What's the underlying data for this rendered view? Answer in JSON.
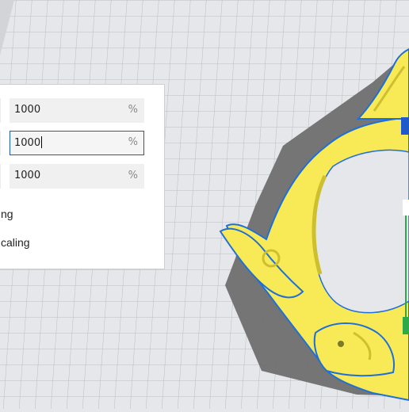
{
  "scale": {
    "x": {
      "value": "1000",
      "unit": "%"
    },
    "y": {
      "value": "1000",
      "unit": "%"
    },
    "z": {
      "value": "1000",
      "unit": "%"
    },
    "option1_label": "ng",
    "option2_label": "caling"
  },
  "colors": {
    "model": "#f7ea56",
    "model_shadow": "#cdbf2e",
    "outline": "#1f6fd9",
    "floor": "#e6e7ea",
    "grid": "#b9bcc2",
    "shadow": "#6e6e6e",
    "handle_blue": "#1f58c9",
    "handle_green": "#2fa84a",
    "field_border_active": "#1b5bb4"
  }
}
